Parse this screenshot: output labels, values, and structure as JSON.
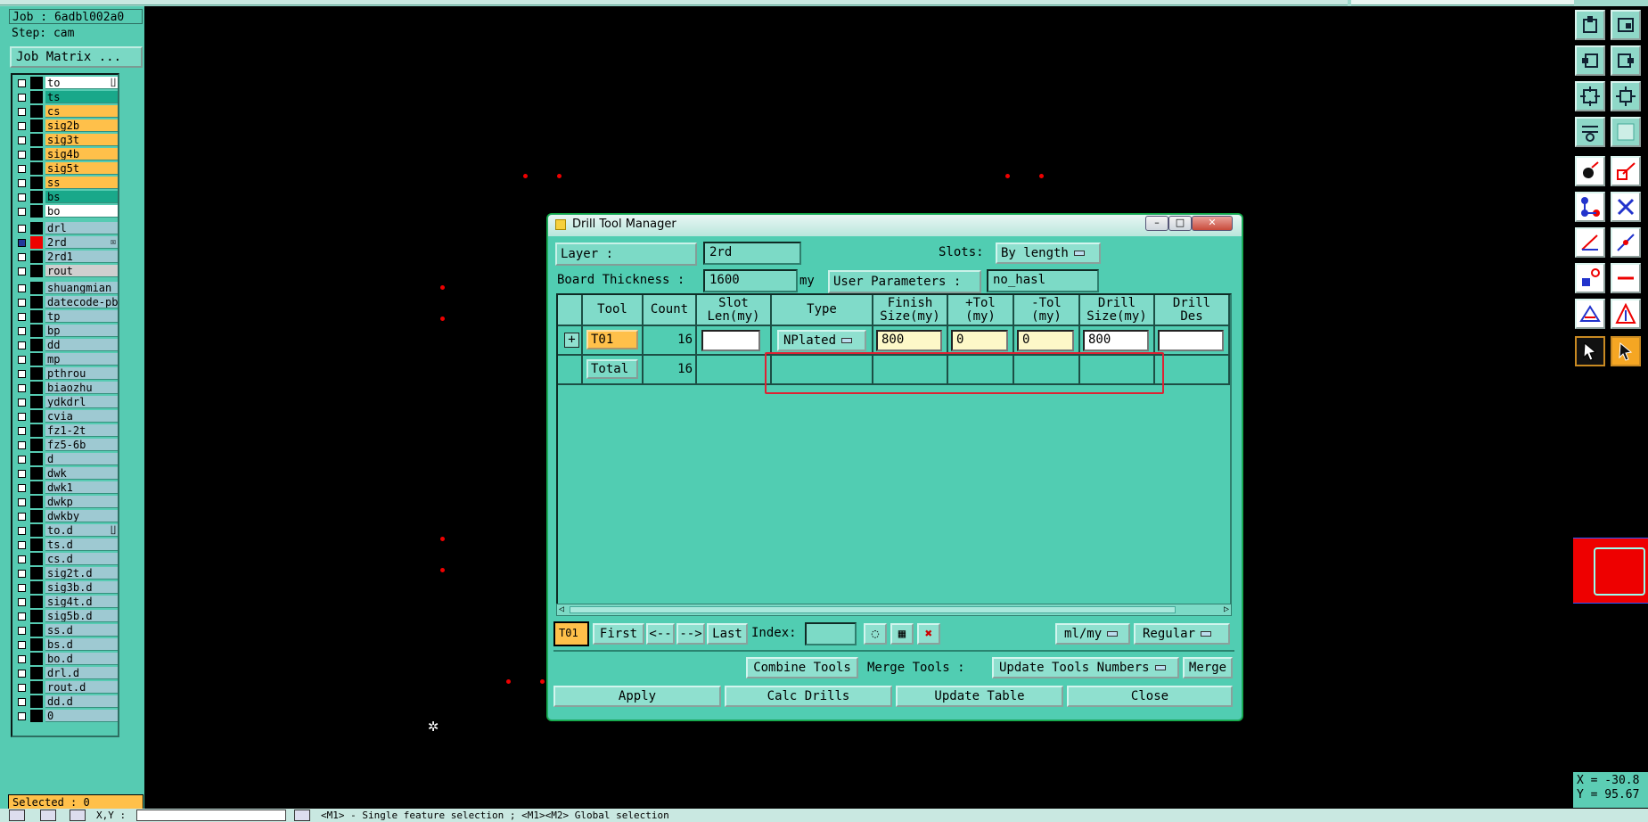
{
  "job": {
    "job_label": "Job : 6adbl002a0",
    "step_label": "Step: cam",
    "matrix_button": "Job Matrix ..."
  },
  "layers": [
    {
      "name": "to",
      "color": "#ffffff",
      "mark": "∐"
    },
    {
      "name": "ts",
      "color": "#19a88a"
    },
    {
      "name": "cs",
      "color": "#ffc04a"
    },
    {
      "name": "sig2b",
      "color": "#ffc04a"
    },
    {
      "name": "sig3t",
      "color": "#ffc04a"
    },
    {
      "name": "sig4b",
      "color": "#ffc04a"
    },
    {
      "name": "sig5t",
      "color": "#ffc04a"
    },
    {
      "name": "ss",
      "color": "#ffc04a"
    },
    {
      "name": "bs",
      "color": "#19a88a"
    },
    {
      "name": "bo",
      "color": "#ffffff"
    },
    {
      "name": "drl",
      "color": "#9ec9d2"
    },
    {
      "name": "2rd",
      "color": "#9ec9d2",
      "active": true,
      "mark": "☒"
    },
    {
      "name": "2rd1",
      "color": "#9ec9d2"
    },
    {
      "name": "rout",
      "color": "#cfcfcf"
    },
    {
      "name": "shuangmian",
      "color": "#9ec9d2"
    },
    {
      "name": "datecode-pbe",
      "color": "#9ec9d2"
    },
    {
      "name": "tp",
      "color": "#9ec9d2"
    },
    {
      "name": "bp",
      "color": "#9ec9d2"
    },
    {
      "name": "dd",
      "color": "#9ec9d2"
    },
    {
      "name": "mp",
      "color": "#9ec9d2"
    },
    {
      "name": "pthrou",
      "color": "#9ec9d2"
    },
    {
      "name": "biaozhu",
      "color": "#9ec9d2"
    },
    {
      "name": "ydkdrl",
      "color": "#9ec9d2"
    },
    {
      "name": "cvia",
      "color": "#9ec9d2"
    },
    {
      "name": "fz1-2t",
      "color": "#9ec9d2"
    },
    {
      "name": "fz5-6b",
      "color": "#9ec9d2"
    },
    {
      "name": "d",
      "color": "#9ec9d2"
    },
    {
      "name": "dwk",
      "color": "#9ec9d2"
    },
    {
      "name": "dwk1",
      "color": "#9ec9d2"
    },
    {
      "name": "dwkp",
      "color": "#9ec9d2"
    },
    {
      "name": "dwkby",
      "color": "#9ec9d2"
    },
    {
      "name": "to.d",
      "color": "#9ec9d2",
      "mark": "∐"
    },
    {
      "name": "ts.d",
      "color": "#9ec9d2"
    },
    {
      "name": "cs.d",
      "color": "#9ec9d2"
    },
    {
      "name": "sig2t.d",
      "color": "#9ec9d2"
    },
    {
      "name": "sig3b.d",
      "color": "#9ec9d2"
    },
    {
      "name": "sig4t.d",
      "color": "#9ec9d2"
    },
    {
      "name": "sig5b.d",
      "color": "#9ec9d2"
    },
    {
      "name": "ss.d",
      "color": "#9ec9d2"
    },
    {
      "name": "bs.d",
      "color": "#9ec9d2"
    },
    {
      "name": "bo.d",
      "color": "#9ec9d2"
    },
    {
      "name": "drl.d",
      "color": "#9ec9d2"
    },
    {
      "name": "rout.d",
      "color": "#9ec9d2"
    },
    {
      "name": "dd.d",
      "color": "#9ec9d2"
    },
    {
      "name": "0",
      "color": "#9ec9d2"
    }
  ],
  "status": {
    "selected": "Selected : 0",
    "message": "<M1> - Single feature selection ; <M1><M2> Global selection",
    "xy_label": "X,Y :"
  },
  "coords": {
    "x": "X = -30.8",
    "y": "Y = 95.67"
  },
  "dialog": {
    "title": "Drill Tool Manager",
    "layer_label": "Layer            :",
    "layer_value": "2rd",
    "slots_label": "Slots:",
    "slots_value": "By length",
    "thickness_label": "Board Thickness :",
    "thickness_value": "1600",
    "thickness_unit": "my",
    "user_params_label": "User Parameters :",
    "user_params_value": "no_hasl",
    "headers": {
      "tool": "Tool",
      "count": "Count",
      "slot_len": [
        "Slot",
        "Len(my)"
      ],
      "type": "Type",
      "finish": [
        "Finish",
        "Size(my)"
      ],
      "ptol": [
        "+Tol",
        "(my)"
      ],
      "ntol": [
        "-Tol",
        "(my)"
      ],
      "drill": [
        "Drill",
        "Size(my)"
      ],
      "des": [
        "Drill",
        "Des"
      ]
    },
    "rows": [
      {
        "tool": "T01",
        "count": "16",
        "slot_len": "",
        "type": "NPlated",
        "finish": "800",
        "ptol": "0",
        "ntol": "0",
        "drill": "800",
        "des": ""
      }
    ],
    "total": {
      "label": "Total",
      "count": "16"
    },
    "nav": {
      "current": "T01",
      "first": "First",
      "prev": "<--",
      "next": "-->",
      "last": "Last",
      "index_label": "Index:",
      "index_value": "",
      "units": "ml/my",
      "mode": "Regular"
    },
    "actions": {
      "combine": "Combine Tools",
      "merge_label": "Merge Tools  :",
      "merge_mode": "Update Tools Numbers",
      "merge": "Merge"
    },
    "footer": {
      "apply": "Apply",
      "calc": "Calc Drills",
      "update": "Update Table",
      "close": "Close"
    }
  }
}
